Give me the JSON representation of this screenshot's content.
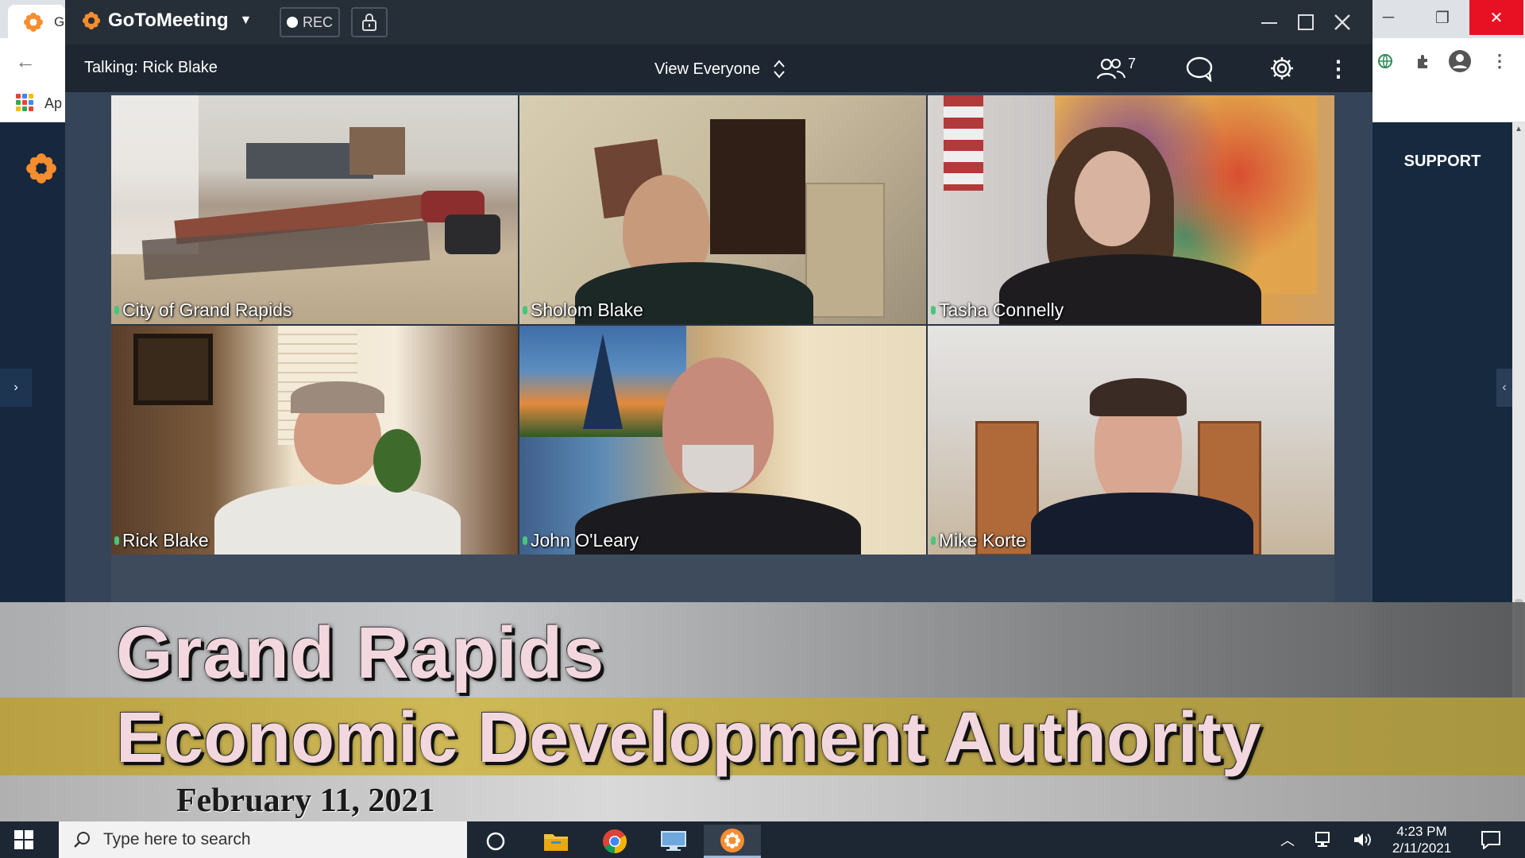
{
  "browser": {
    "tab_label": "G",
    "apps_label": "Ap",
    "support_label": "SUPPORT"
  },
  "gtm": {
    "brand": "GoToMeeting",
    "rec_label": "REC",
    "talking": "Talking: Rick Blake",
    "view_label": "View Everyone",
    "participant_count": "7",
    "participants": [
      {
        "name": "City of Grand Rapids"
      },
      {
        "name": "Sholom Blake"
      },
      {
        "name": "Tasha Connelly"
      },
      {
        "name": "Rick Blake"
      },
      {
        "name": "John O'Leary"
      },
      {
        "name": "Mike Korte"
      }
    ]
  },
  "overlay": {
    "title": "Grand Rapids",
    "subtitle": "Economic Development Authority",
    "date": "February 11, 2021"
  },
  "taskbar": {
    "search_placeholder": "Type here to search",
    "time": "4:23 PM",
    "date": "2/11/2021"
  },
  "colors": {
    "gtm_orange": "#f68d2e",
    "titlebar": "#262e38",
    "toolbar": "#1e2731",
    "overlay_gold": "#cfb957",
    "title_text": "#f3d7de"
  },
  "icons": [
    "gotomeeting-logo-icon",
    "record-icon",
    "lock-icon",
    "minimize-icon",
    "maximize-icon",
    "close-icon",
    "sort-arrows-icon",
    "people-icon",
    "chat-icon",
    "gear-icon",
    "more-vertical-icon",
    "windows-start-icon",
    "search-icon",
    "cortana-icon",
    "file-explorer-icon",
    "chrome-icon",
    "network-icon",
    "notification-icon"
  ]
}
